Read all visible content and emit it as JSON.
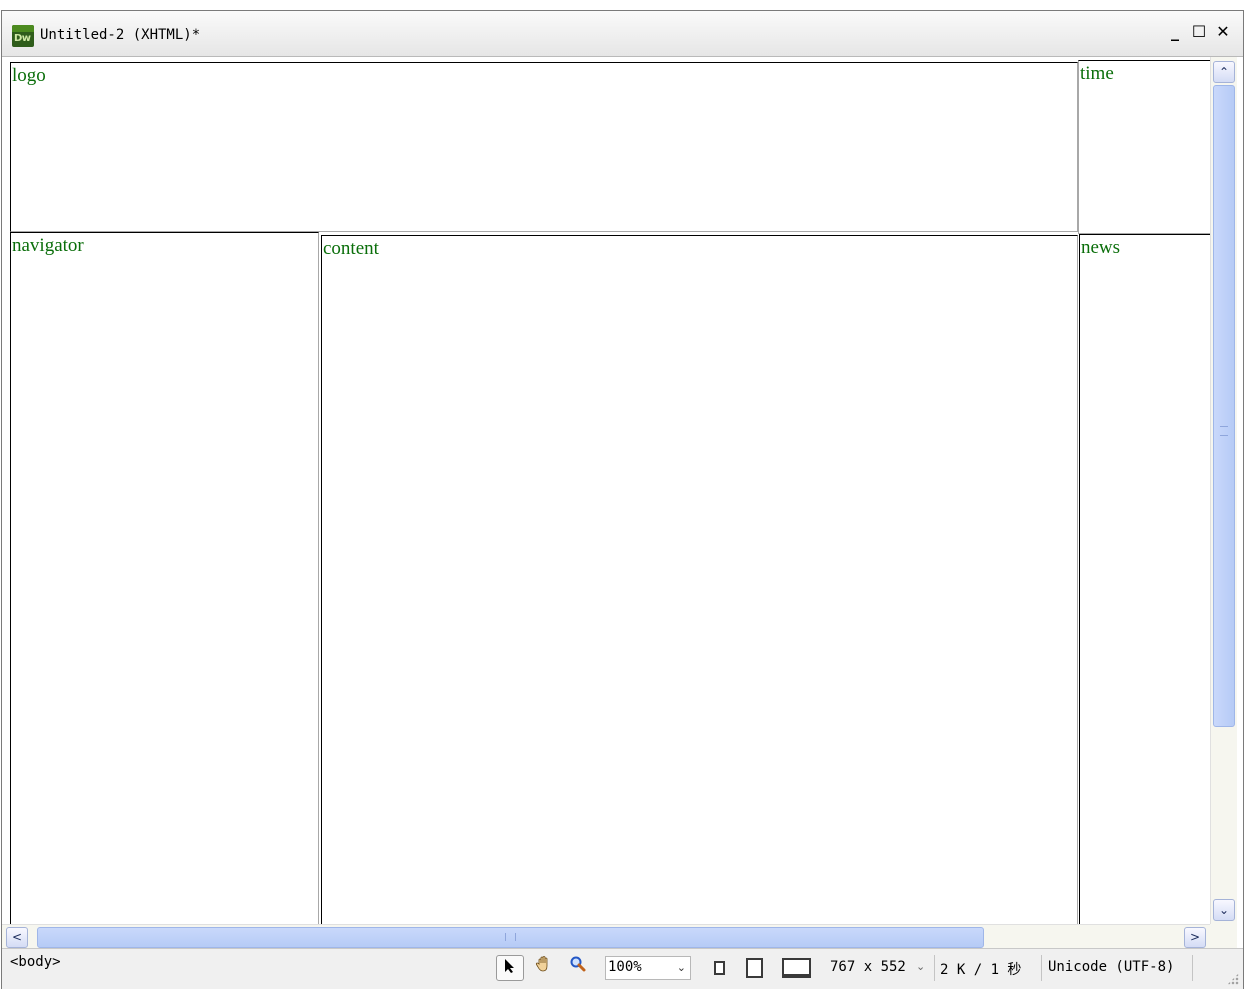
{
  "window": {
    "title": "Untitled-2 (XHTML)*",
    "app_logo": "Dw",
    "controls": {
      "minimize": "_",
      "maximize": "☐",
      "close": "✕"
    }
  },
  "layout_regions": {
    "logo": "logo",
    "time": "time",
    "navigator": "navigator",
    "content": "content",
    "news": "news"
  },
  "scrollbars": {
    "up": "⌃",
    "down": "⌄",
    "left": "<",
    "right": ">"
  },
  "statusbar": {
    "tag_selector": "<body>",
    "zoom": "100%",
    "dimensions": "767 x 552",
    "size": "2 K / 1 秒",
    "encoding": "Unicode (UTF-8)"
  },
  "colors": {
    "region_label": "#0a6e0a",
    "scroll_thumb": "#b6cbf6"
  },
  "icons": {
    "select_tool": "pointer-icon",
    "hand_tool": "hand-icon",
    "zoom_tool": "magnifier-icon"
  }
}
